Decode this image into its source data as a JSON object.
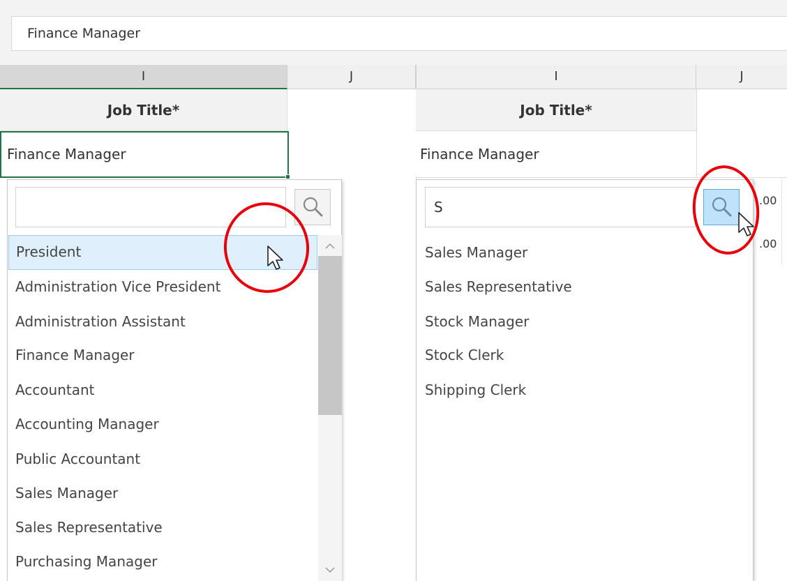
{
  "formula_bar": {
    "value": "Finance Manager"
  },
  "column_headers": {
    "left": {
      "col_i": "I",
      "col_j": "J"
    },
    "right": {
      "col_i": "I",
      "col_j": "J"
    }
  },
  "left_panel": {
    "header_cell": "Job Title*",
    "value_cell": "Finance Manager",
    "search": {
      "value": "",
      "placeholder": ""
    },
    "list_items": [
      "President",
      "Administration Vice President",
      "Administration Assistant",
      "Finance Manager",
      "Accountant",
      "Accounting Manager",
      "Public Accountant",
      "Sales Manager",
      "Sales Representative",
      "Purchasing Manager"
    ],
    "selected_index": 0
  },
  "right_panel": {
    "header_cell": "Job Title*",
    "value_cell": "Finance Manager",
    "search": {
      "value": "S",
      "placeholder": ""
    },
    "list_items": [
      "Sales Manager",
      "Sales Representative",
      "Stock Manager",
      "Stock Clerk",
      "Shipping Clerk"
    ],
    "partial_values": [
      ".00",
      ".00"
    ]
  },
  "icons": {
    "search": "magnifier-icon",
    "cursor": "mouse-pointer-icon",
    "scroll_up": "chevron-up-icon",
    "scroll_down": "chevron-down-icon"
  },
  "colors": {
    "selection_border": "#217346",
    "highlight_circle": "#e8000b",
    "selected_item_bg": "#dff0fc",
    "active_search_button": "#bfe3fb"
  }
}
